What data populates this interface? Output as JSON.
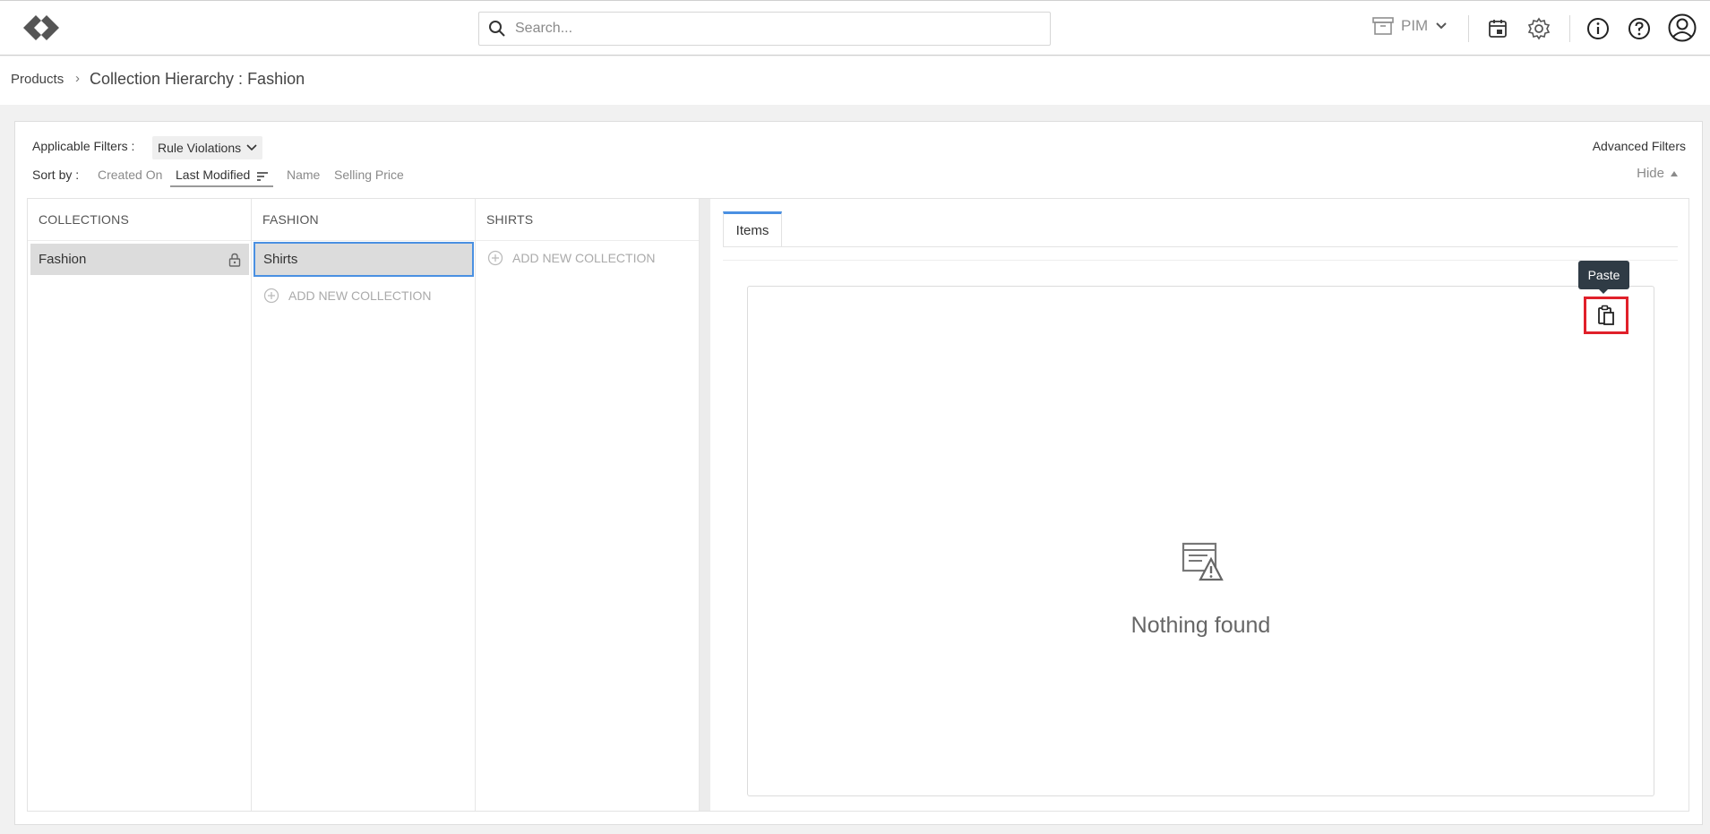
{
  "header": {
    "search_placeholder": "Search...",
    "module_label": "PIM"
  },
  "breadcrumb": {
    "root": "Products",
    "separator": "›",
    "title": "Collection Hierarchy : Fashion"
  },
  "filters": {
    "label": "Applicable Filters :",
    "selected": "Rule Violations",
    "advanced": "Advanced Filters",
    "hide_label": "Hide"
  },
  "sort": {
    "label": "Sort by :",
    "options": [
      "Created On",
      "Last Modified",
      "Name",
      "Selling Price"
    ],
    "active": "Last Modified"
  },
  "columns": [
    {
      "heading": "COLLECTIONS",
      "items": [
        "Fashion"
      ]
    },
    {
      "heading": "FASHION",
      "items": [
        "Shirts"
      ],
      "add_label": "ADD NEW COLLECTION"
    },
    {
      "heading": "SHIRTS",
      "items": [],
      "add_label": "ADD NEW COLLECTION"
    }
  ],
  "panel": {
    "tab": "Items",
    "tooltip": "Paste",
    "empty_message": "Nothing found"
  },
  "colors": {
    "accent": "#4a90e2",
    "highlight": "#e0202a",
    "tooltip_bg": "#2f3b45"
  }
}
